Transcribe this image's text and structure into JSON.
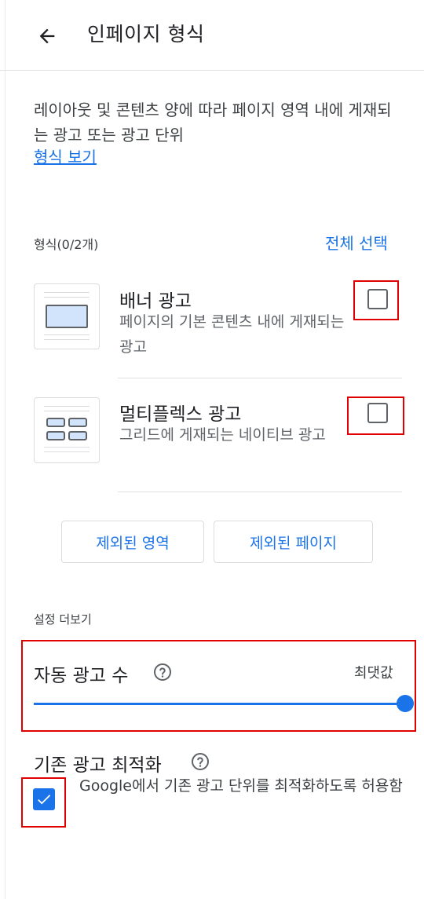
{
  "header": {
    "title": "인페이지 형식"
  },
  "intro": {
    "description": "레이아웃 및 콘텐츠 양에 따라 페이지 영역 내에 게재되는 광고 또는 광고 단위",
    "view_formats_link": "형식 보기"
  },
  "formats": {
    "label": "형식(0/2개)",
    "select_all": "전체 선택",
    "items": [
      {
        "title": "배너 광고",
        "description": "페이지의 기본 콘텐츠 내에 게재되는 광고",
        "checked": false
      },
      {
        "title": "멀티플렉스 광고",
        "description": "그리드에 게재되는 네이티브 광고",
        "checked": false
      }
    ]
  },
  "buttons": {
    "excluded_areas": "제외된 영역",
    "excluded_pages": "제외된 페이지"
  },
  "settings": {
    "section_label": "설정 더보기",
    "auto_ads_count": {
      "title": "자동 광고 수",
      "value_label": "최댓값",
      "slider_value": 1.0
    },
    "existing_ad_optimization": {
      "title": "기존 광고 최적화",
      "option_label": "Google에서 기존 광고 단위를 최적화하도록 허용함",
      "checked": true
    }
  },
  "colors": {
    "accent": "#1a73e8",
    "highlight": "#e00000",
    "thumb_fill": "#d2e3fc"
  },
  "icons": [
    "back-arrow-icon",
    "help-icon",
    "check-icon"
  ]
}
